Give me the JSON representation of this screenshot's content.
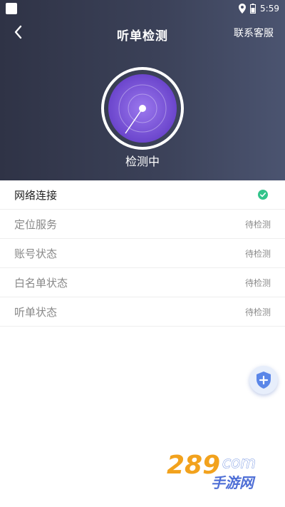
{
  "status_bar": {
    "time": "5:59"
  },
  "header": {
    "title": "听单检测",
    "service_link": "联系客服"
  },
  "scan": {
    "status": "检测中"
  },
  "checks": [
    {
      "label": "网络连接",
      "state": "done"
    },
    {
      "label": "定位服务",
      "status": "待检测"
    },
    {
      "label": "账号状态",
      "status": "待检测"
    },
    {
      "label": "白名单状态",
      "status": "待检测"
    },
    {
      "label": "听单状态",
      "status": "待检测"
    }
  ],
  "colors": {
    "header_start": "#2f3346",
    "header_end": "#4b5470",
    "radar_purple": "#7a52d8",
    "check_green": "#33c48b",
    "fab_blue": "#5a86e8"
  },
  "icons": {
    "back": "chevron-left-icon",
    "check": "check-circle-icon",
    "fab": "shield-plus-icon"
  },
  "watermark": {
    "number": "289",
    "suffix": "com",
    "text": "手游网"
  }
}
